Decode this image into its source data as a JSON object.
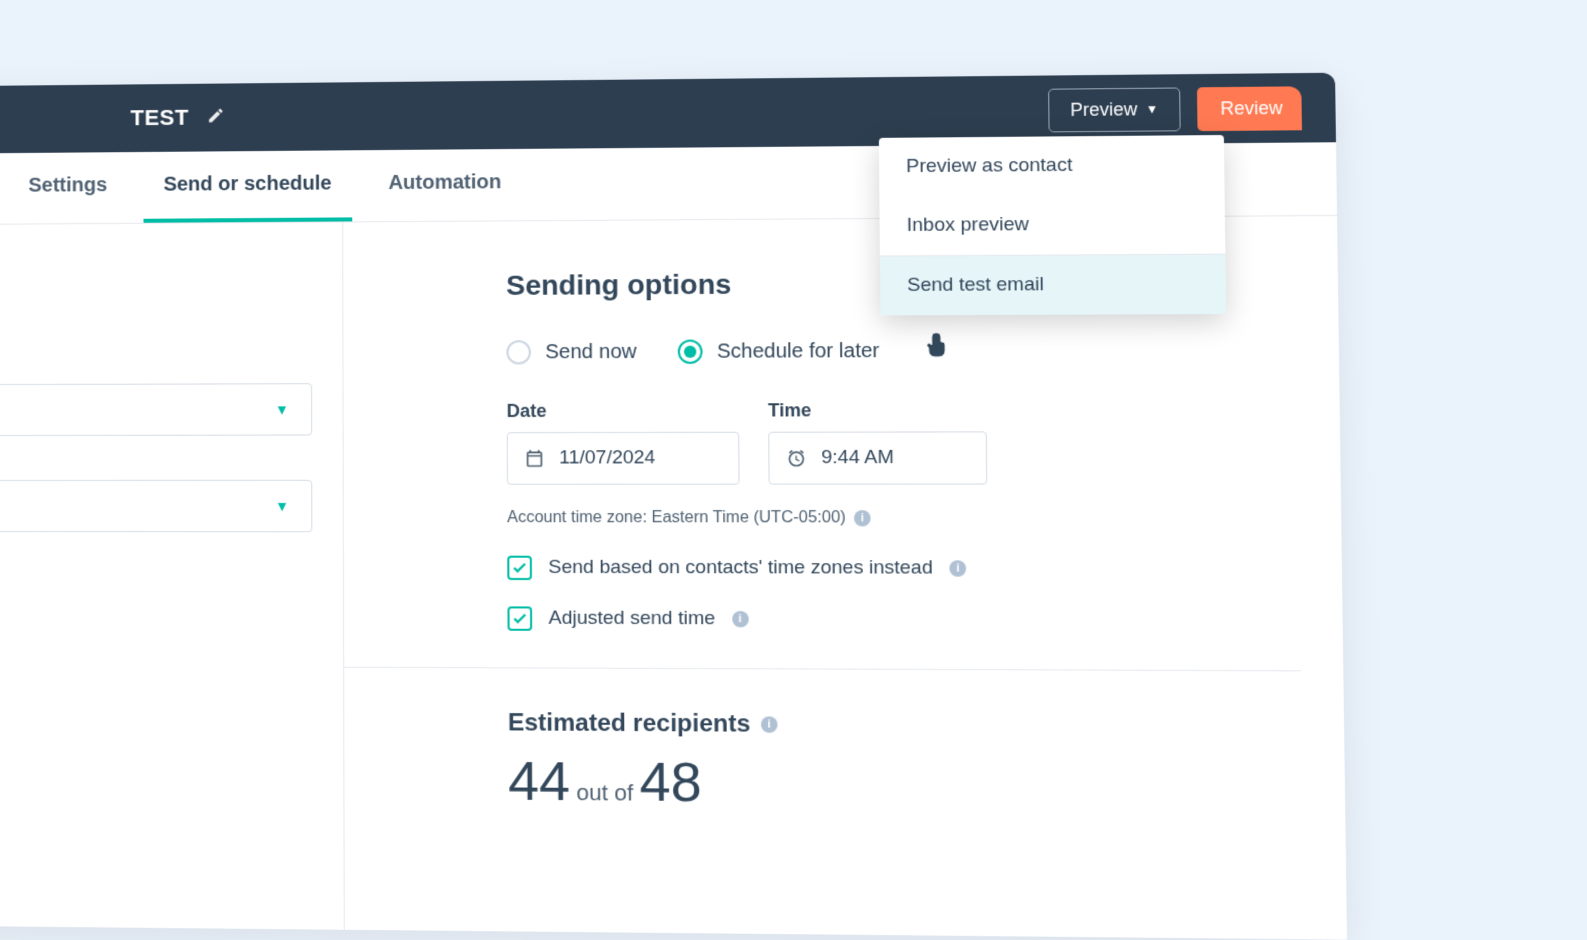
{
  "header": {
    "title": "TEST",
    "preview_button": "Preview",
    "review_button": "Review"
  },
  "tabs": {
    "settings": "Settings",
    "send_schedule": "Send or schedule",
    "automation": "Automation"
  },
  "preview_menu": {
    "preview_as_contact": "Preview as contact",
    "inbox_preview": "Inbox preview",
    "send_test_email": "Send test email"
  },
  "sending_options": {
    "title": "Sending options",
    "send_now_label": "Send now",
    "schedule_later_label": "Schedule for later",
    "date_label": "Date",
    "date_value": "11/07/2024",
    "time_label": "Time",
    "time_value": "9:44 AM",
    "timezone_text": "Account time zone: Eastern Time (UTC-05:00)",
    "contacts_tz_label": "Send based on contacts' time zones instead",
    "adjusted_label": "Adjusted send time"
  },
  "recipients": {
    "title": "Estimated recipients",
    "count": "44",
    "out_of": "out of",
    "total": "48"
  }
}
